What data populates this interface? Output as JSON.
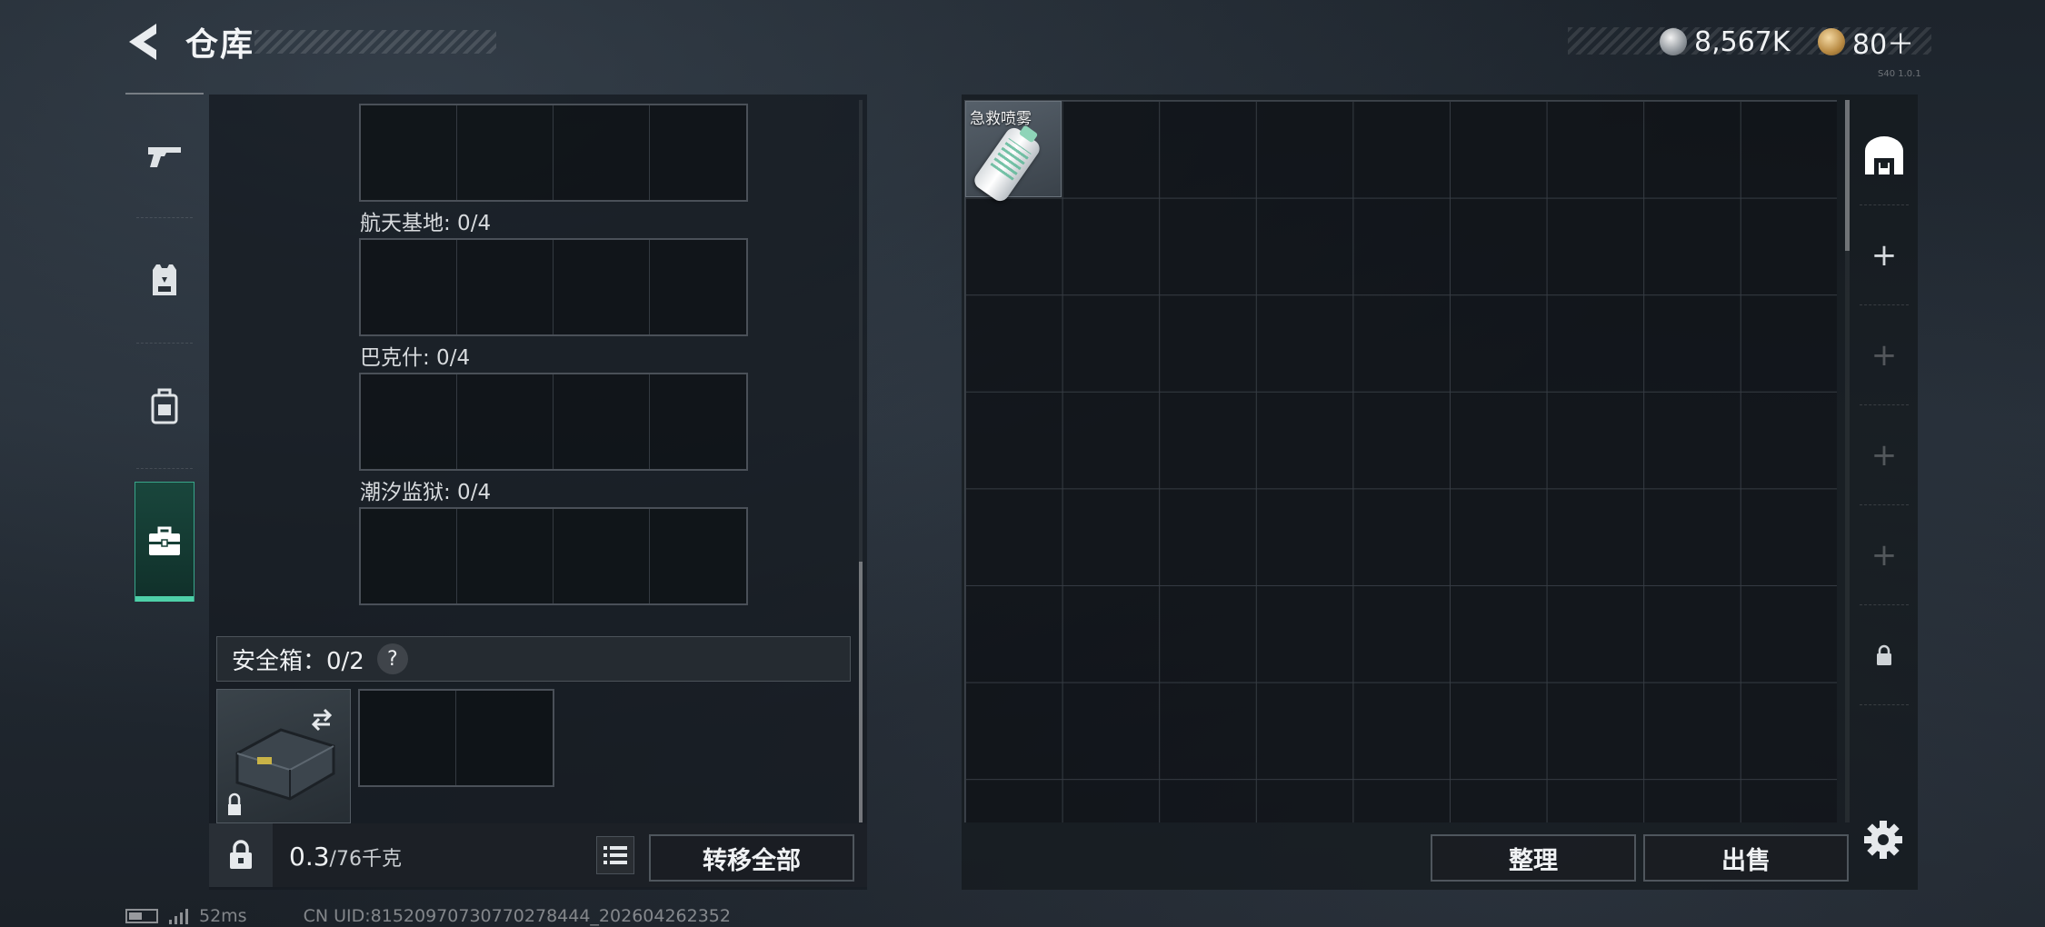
{
  "header": {
    "title": "仓库",
    "currency_silver": "8,567K",
    "currency_gold": "80＋",
    "version_tag": "S40 1.0.1"
  },
  "tabs": [
    {
      "icon": "pistol-icon",
      "active": false
    },
    {
      "icon": "armor-vest-icon",
      "active": false
    },
    {
      "icon": "backpack-icon",
      "active": false
    },
    {
      "icon": "toolbox-icon",
      "active": true
    }
  ],
  "left_panel": {
    "map_labels": [
      "航天基地: 0/4",
      "巴克什: 0/4",
      "潮汐监狱: 0/4"
    ],
    "safe_box_label": "安全箱：0/2",
    "help_label": "?",
    "weight_value": "0.3",
    "weight_capacity": "/76千克",
    "transfer_all_label": "转移全部"
  },
  "stash": {
    "item_label": "急救喷雾",
    "sort_label": "整理",
    "sell_label": "出售",
    "side_slots": [
      "+",
      "+",
      "+",
      "+"
    ]
  },
  "status_bar": {
    "ping": "52ms",
    "uid": "CN UID:81520970730770278444_202604262352"
  },
  "colors": {
    "accent_green": "#4ed0a8",
    "panel_bg": "#161b21"
  }
}
